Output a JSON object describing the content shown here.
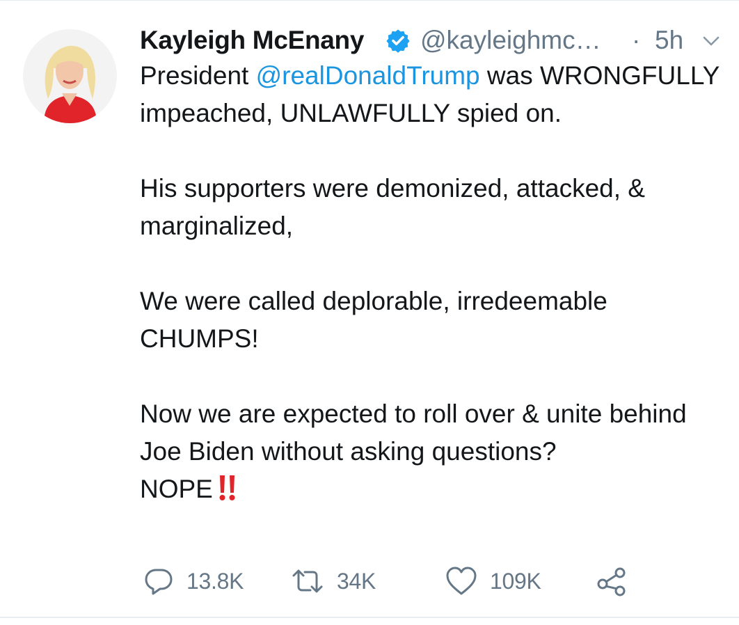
{
  "tweet": {
    "author": {
      "display_name": "Kayleigh McEnany",
      "handle": "@kayleighmc…",
      "verified": true
    },
    "time_separator": "·",
    "time": "5h",
    "body": {
      "p1_before": "President ",
      "mention": "@realDonaldTrump",
      "p1_after": " was WRONGFULLY impeached, UNLAWFULLY spied on.",
      "p2": "His supporters were demonized, attacked, & marginalized,",
      "p3": "We were called deplorable, irredeemable CHUMPS!",
      "p4": "Now we are expected to roll over & unite behind Joe Biden without asking questions?",
      "p5": "NOPE",
      "p5_emoji": "double-exclamation-icon"
    },
    "actions": {
      "reply": {
        "icon": "reply-icon",
        "count": "13.8K"
      },
      "retweet": {
        "icon": "retweet-icon",
        "count": "34K"
      },
      "like": {
        "icon": "heart-icon",
        "count": "109K"
      },
      "share": {
        "icon": "share-icon"
      }
    }
  },
  "colors": {
    "text": "#14171a",
    "secondary": "#657786",
    "link": "#1b95e0",
    "verified": "#1da1f2",
    "emoji": "#e0242a"
  }
}
